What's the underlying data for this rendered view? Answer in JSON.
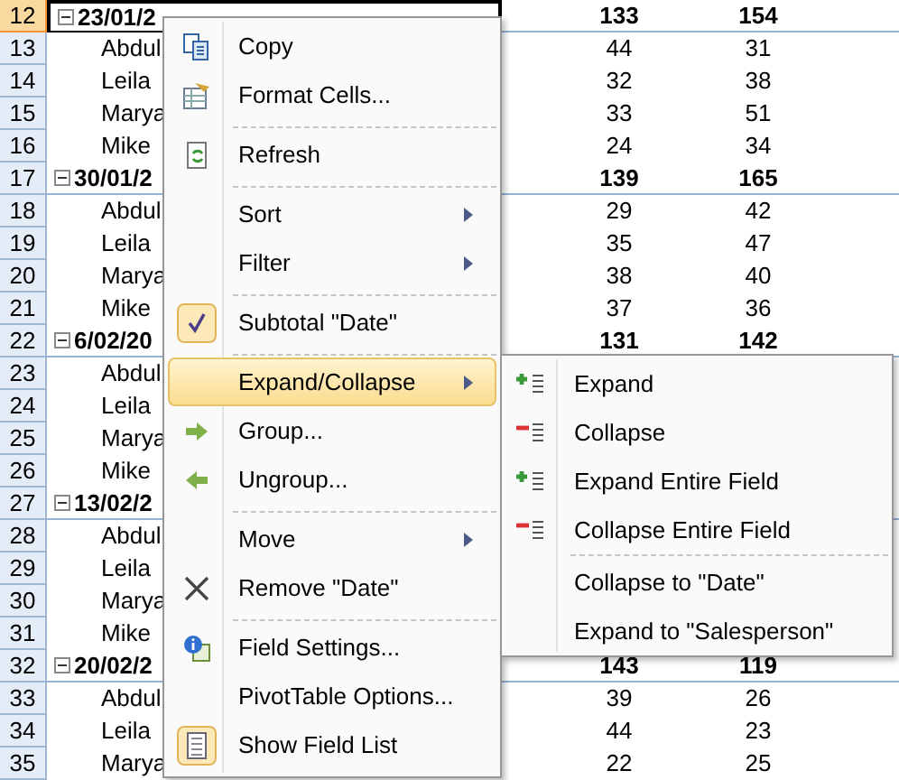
{
  "sheet": {
    "rows": [
      {
        "number": "12",
        "kind": "group",
        "label": "23/01/2",
        "c": "133",
        "d": "154",
        "selected": true
      },
      {
        "number": "13",
        "kind": "item",
        "label": "Abdul",
        "c": "44",
        "d": "31",
        "selected": false
      },
      {
        "number": "14",
        "kind": "item",
        "label": "Leila",
        "c": "32",
        "d": "38",
        "selected": false
      },
      {
        "number": "15",
        "kind": "item",
        "label": "Marya",
        "c": "33",
        "d": "51",
        "selected": false
      },
      {
        "number": "16",
        "kind": "item",
        "label": "Mike",
        "c": "24",
        "d": "34",
        "selected": false
      },
      {
        "number": "17",
        "kind": "group",
        "label": "30/01/2",
        "c": "139",
        "d": "165",
        "selected": false
      },
      {
        "number": "18",
        "kind": "item",
        "label": "Abdul",
        "c": "29",
        "d": "42",
        "selected": false
      },
      {
        "number": "19",
        "kind": "item",
        "label": "Leila",
        "c": "35",
        "d": "47",
        "selected": false
      },
      {
        "number": "20",
        "kind": "item",
        "label": "Marya",
        "c": "38",
        "d": "40",
        "selected": false
      },
      {
        "number": "21",
        "kind": "item",
        "label": "Mike",
        "c": "37",
        "d": "36",
        "selected": false
      },
      {
        "number": "22",
        "kind": "group",
        "label": "6/02/20",
        "c": "131",
        "d": "142",
        "selected": false
      },
      {
        "number": "23",
        "kind": "item",
        "label": "Abdul",
        "selected": false
      },
      {
        "number": "24",
        "kind": "item",
        "label": "Leila",
        "selected": false
      },
      {
        "number": "25",
        "kind": "item",
        "label": "Marya",
        "selected": false
      },
      {
        "number": "26",
        "kind": "item",
        "label": "Mike",
        "selected": false
      },
      {
        "number": "27",
        "kind": "group",
        "label": "13/02/2",
        "selected": false
      },
      {
        "number": "28",
        "kind": "item",
        "label": "Abdul",
        "selected": false
      },
      {
        "number": "29",
        "kind": "item",
        "label": "Leila",
        "selected": false
      },
      {
        "number": "30",
        "kind": "item",
        "label": "Marya",
        "selected": false
      },
      {
        "number": "31",
        "kind": "item",
        "label": "Mike",
        "selected": false
      },
      {
        "number": "32",
        "kind": "group",
        "label": "20/02/2",
        "c": "143",
        "d": "119",
        "selected": false
      },
      {
        "number": "33",
        "kind": "item",
        "label": "Abdul",
        "c": "39",
        "d": "26",
        "selected": false
      },
      {
        "number": "34",
        "kind": "item",
        "label": "Leila",
        "c": "44",
        "d": "23",
        "selected": false
      },
      {
        "number": "35",
        "kind": "item",
        "label": "Marya",
        "c": "22",
        "d": "25",
        "selected": false
      }
    ]
  },
  "context_menu": {
    "items": [
      {
        "kind": "item",
        "label": "Copy",
        "submenu": false,
        "selected": false,
        "checked": false
      },
      {
        "kind": "item",
        "label": "Format Cells...",
        "submenu": false,
        "selected": false,
        "checked": false
      },
      {
        "kind": "separator"
      },
      {
        "kind": "item",
        "label": "Refresh",
        "submenu": false,
        "selected": false,
        "checked": false
      },
      {
        "kind": "separator"
      },
      {
        "kind": "item",
        "label": "Sort",
        "submenu": true,
        "selected": false,
        "checked": false
      },
      {
        "kind": "item",
        "label": "Filter",
        "submenu": true,
        "selected": false,
        "checked": false
      },
      {
        "kind": "separator"
      },
      {
        "kind": "item",
        "label": "Subtotal \"Date\"",
        "submenu": false,
        "selected": false,
        "checked": true
      },
      {
        "kind": "separator"
      },
      {
        "kind": "item",
        "label": "Expand/Collapse",
        "submenu": true,
        "selected": true,
        "checked": false
      },
      {
        "kind": "item",
        "label": "Group...",
        "submenu": false,
        "selected": false,
        "checked": false
      },
      {
        "kind": "item",
        "label": "Ungroup...",
        "submenu": false,
        "selected": false,
        "checked": false
      },
      {
        "kind": "separator"
      },
      {
        "kind": "item",
        "label": "Move",
        "submenu": true,
        "selected": false,
        "checked": false
      },
      {
        "kind": "item",
        "label": "Remove \"Date\"",
        "submenu": false,
        "selected": false,
        "checked": false
      },
      {
        "kind": "separator"
      },
      {
        "kind": "item",
        "label": "Field Settings...",
        "submenu": false,
        "selected": false,
        "checked": false
      },
      {
        "kind": "item",
        "label": "PivotTable Options...",
        "submenu": false,
        "selected": false,
        "checked": false
      },
      {
        "kind": "item",
        "label": "Show Field List",
        "submenu": false,
        "selected": false,
        "checked": true
      }
    ]
  },
  "submenu": {
    "items": [
      {
        "kind": "item",
        "label": "Expand"
      },
      {
        "kind": "item",
        "label": "Collapse"
      },
      {
        "kind": "item",
        "label": "Expand Entire Field"
      },
      {
        "kind": "item",
        "label": "Collapse Entire Field"
      },
      {
        "kind": "separator"
      },
      {
        "kind": "item",
        "label": "Collapse to \"Date\""
      },
      {
        "kind": "item",
        "label": "Expand to \"Salesperson\""
      }
    ]
  }
}
